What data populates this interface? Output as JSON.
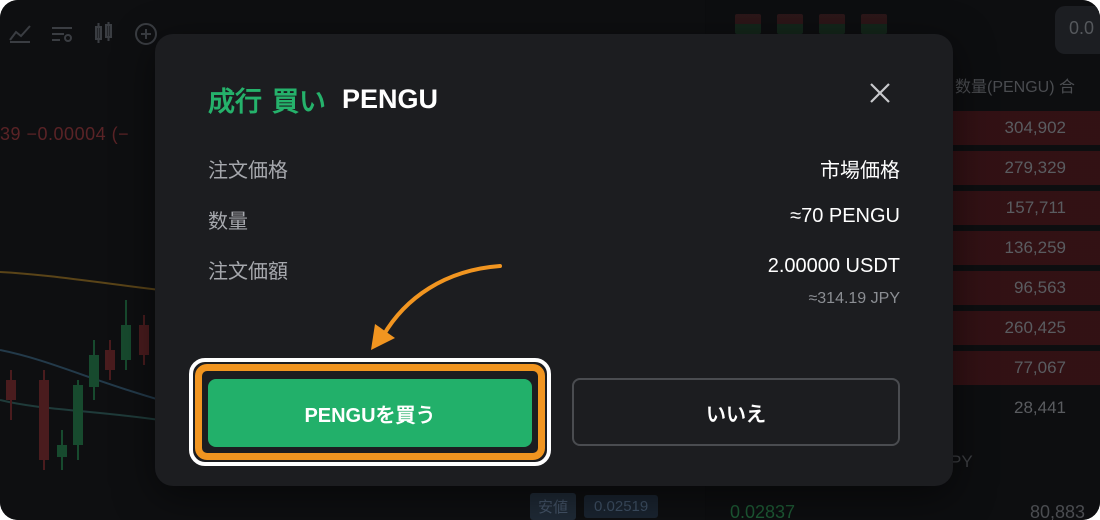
{
  "background": {
    "price_change": "39  −0.00004 (−",
    "book_header": "数量(PENGU)  合",
    "top_input_value": "0.0",
    "book_values": [
      "304,902",
      "279,329",
      "157,711",
      "136,259",
      "96,563",
      "260,425",
      "77,067",
      "28,441"
    ],
    "jpy_fragment": "PY",
    "bottom_tag": "安値",
    "bottom_value": "0.02519",
    "bottom_green_price": "0.02837",
    "bottom_right_value": "80,883"
  },
  "modal": {
    "title": {
      "order_type": "成行",
      "side": "買い",
      "symbol": "PENGU"
    },
    "close_icon": "close-icon",
    "details": [
      {
        "label": "注文価格",
        "value": "市場価格"
      },
      {
        "label": "数量",
        "value": "≈70 PENGU"
      },
      {
        "label": "注文価額",
        "value": "2.00000 USDT",
        "sub": "≈314.19 JPY"
      }
    ],
    "buy_button_label": "PENGUを買う",
    "cancel_button_label": "いいえ"
  },
  "colors": {
    "buy_green": "#22b06a",
    "highlight_orange": "#f19520",
    "modal_bg": "#1c1d20",
    "page_bg": "#0c0d0f"
  }
}
